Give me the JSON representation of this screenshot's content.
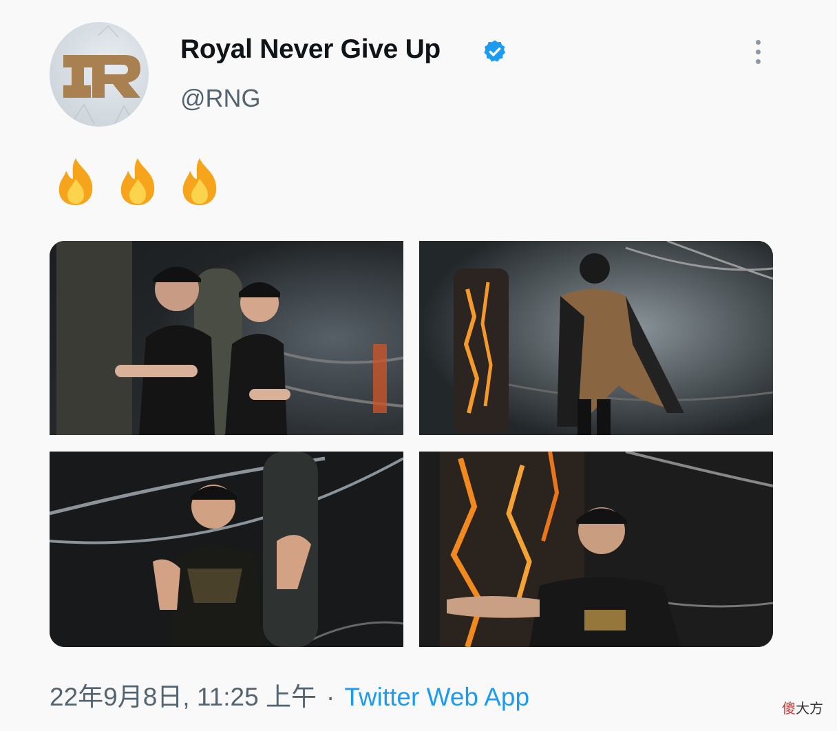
{
  "tweet": {
    "author": {
      "name": "Royal Never Give Up",
      "handle": "@RNG",
      "verified": true
    },
    "text_emojis": [
      "🔥",
      "🔥",
      "🔥"
    ],
    "photos": [
      {
        "description_icon": "photo-two-players-arms-crossed"
      },
      {
        "description_icon": "photo-player-with-cape"
      },
      {
        "description_icon": "photo-player-thumbs-pointing"
      },
      {
        "description_icon": "photo-player-pointing"
      }
    ],
    "timestamp": "22年9月8日, 11:25 上午",
    "separator": "·",
    "source_app": "Twitter Web App"
  },
  "watermark": {
    "highlight": "傻",
    "rest": "大方"
  },
  "colors": {
    "verified_badge": "#1d9bf0",
    "source_link": "#1d9bf0",
    "secondary_text": "#536471",
    "logo_brown": "#a9804f"
  }
}
